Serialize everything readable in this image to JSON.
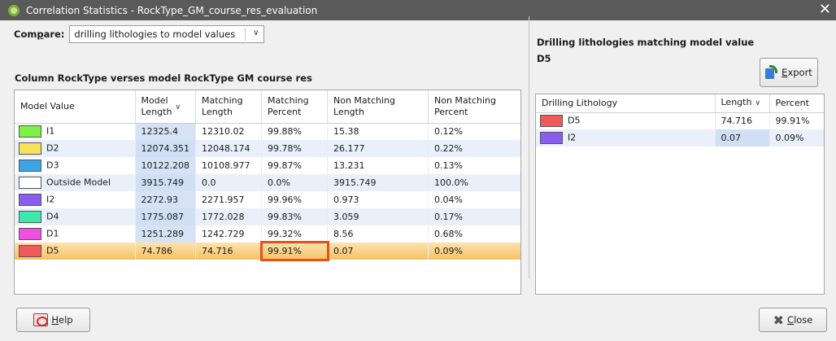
{
  "window": {
    "title": "Correlation Statistics - RockType_GM_course_res_evaluation",
    "close_glyph": "✕"
  },
  "compare": {
    "label_prefix": "Com",
    "label_accel": "p",
    "label_suffix": "are:",
    "selected_value": "drilling lithologies to model values"
  },
  "left": {
    "subtitle": "Column RockType verses model RockType GM course res",
    "headers": [
      "Model Value",
      "Model Length",
      "Matching Length",
      "Matching Percent",
      "Non Matching Length",
      "Non Matching Percent"
    ],
    "rows": [
      {
        "color": "#7ef04a",
        "name": "I1",
        "model_length": "12325.4",
        "matching_length": "12310.02",
        "matching_percent": "99.88%",
        "non_matching_length": "15.38",
        "non_matching_percent": "0.12%"
      },
      {
        "color": "#f7e25a",
        "name": "D2",
        "model_length": "12074.351",
        "matching_length": "12048.174",
        "matching_percent": "99.78%",
        "non_matching_length": "26.177",
        "non_matching_percent": "0.22%"
      },
      {
        "color": "#3ea4e8",
        "name": "D3",
        "model_length": "10122.208",
        "matching_length": "10108.977",
        "matching_percent": "99.87%",
        "non_matching_length": "13.231",
        "non_matching_percent": "0.13%"
      },
      {
        "color": "#ffffff",
        "name": "Outside Model",
        "model_length": "3915.749",
        "matching_length": "0.0",
        "matching_percent": "0.0%",
        "non_matching_length": "3915.749",
        "non_matching_percent": "100.0%"
      },
      {
        "color": "#8a5cf0",
        "name": "I2",
        "model_length": "2272.93",
        "matching_length": "2271.957",
        "matching_percent": "99.96%",
        "non_matching_length": "0.973",
        "non_matching_percent": "0.04%"
      },
      {
        "color": "#3ee8a8",
        "name": "D4",
        "model_length": "1775.087",
        "matching_length": "1772.028",
        "matching_percent": "99.83%",
        "non_matching_length": "3.059",
        "non_matching_percent": "0.17%"
      },
      {
        "color": "#f050e0",
        "name": "D1",
        "model_length": "1251.289",
        "matching_length": "1242.729",
        "matching_percent": "99.32%",
        "non_matching_length": "8.56",
        "non_matching_percent": "0.68%"
      },
      {
        "color": "#f05a5a",
        "name": "D5",
        "model_length": "74.786",
        "matching_length": "74.716",
        "matching_percent": "99.91%",
        "non_matching_length": "0.07",
        "non_matching_percent": "0.09%"
      }
    ]
  },
  "right": {
    "title_line1": "Drilling lithologies matching model value",
    "title_line2": "D5",
    "export_accel": "E",
    "export_rest": "xport",
    "headers": [
      "Drilling Lithology",
      "Length",
      "Percent"
    ],
    "rows": [
      {
        "color": "#f05a5a",
        "name": "D5",
        "length": "74.716",
        "percent": "99.91%"
      },
      {
        "color": "#8a5cf0",
        "name": "I2",
        "length": "0.07",
        "percent": "0.09%"
      }
    ]
  },
  "buttons": {
    "help_accel": "H",
    "help_rest": "elp",
    "close_accel": "C",
    "close_rest": "lose"
  }
}
